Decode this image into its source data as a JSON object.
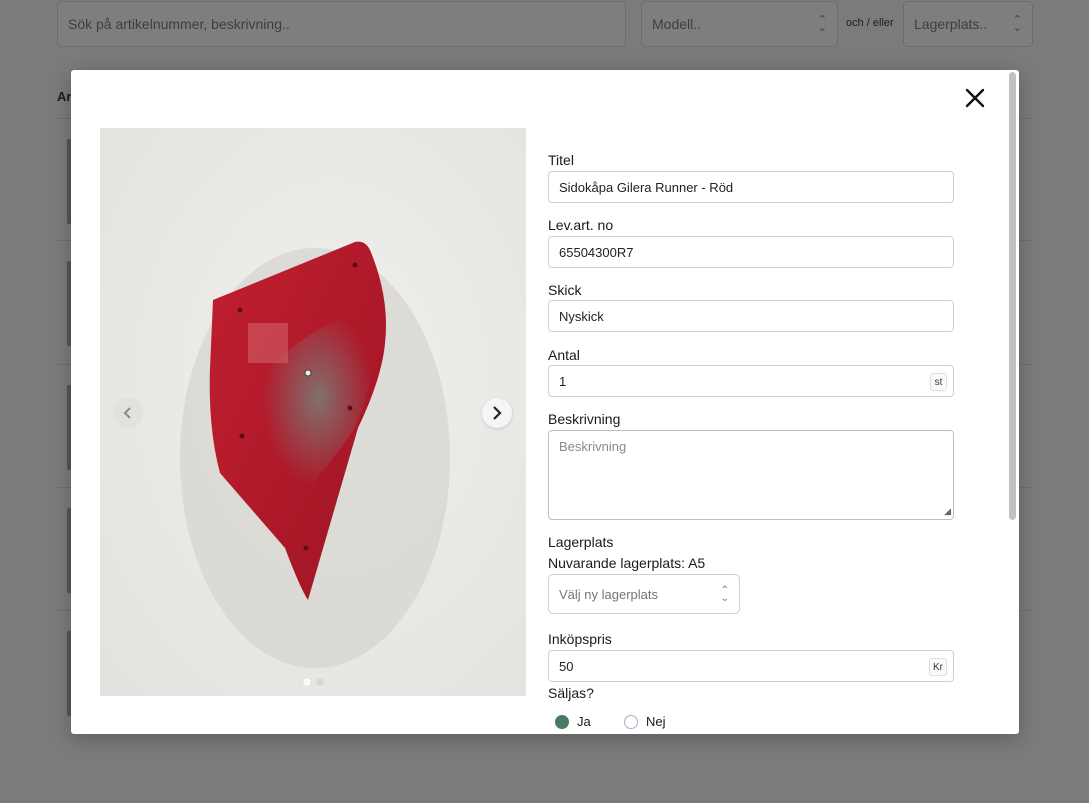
{
  "background": {
    "search_placeholder": "Sök på artikelnummer, beskrivning..",
    "model_placeholder": "Modell..",
    "or_label": "och / eller",
    "location_placeholder": "Lagerplats..",
    "section_heading": "Ar"
  },
  "modal": {
    "close_icon": "close-icon",
    "carousel": {
      "prev_icon": "chevron-left-icon",
      "next_icon": "chevron-right-icon",
      "slide_count": 2,
      "active_slide": 1
    },
    "form": {
      "title_label": "Titel",
      "title_value": "Sidokåpa Gilera Runner - Röd",
      "supplier_no_label": "Lev.art. no",
      "supplier_no_value": "65504300R7",
      "condition_label": "Skick",
      "condition_value": "Nyskick",
      "quantity_label": "Antal",
      "quantity_value": "1",
      "quantity_unit": "st",
      "description_label": "Beskrivning",
      "description_placeholder": "Beskrivning",
      "location_label": "Lagerplats",
      "current_location": "Nuvarande lagerplats: A5",
      "new_location_placeholder": "Välj ny lagerplats",
      "purchase_price_label": "Inköpspris",
      "purchase_price_value": "50",
      "currency": "Kr",
      "for_sale_label": "Säljas?",
      "for_sale_options": [
        "Ja",
        "Nej"
      ],
      "for_sale_selected": "Ja"
    }
  },
  "colors": {
    "overlay_bg": "#7b7b7b",
    "radio_checked": "#4b7a62",
    "part_red": "#b3192a"
  }
}
